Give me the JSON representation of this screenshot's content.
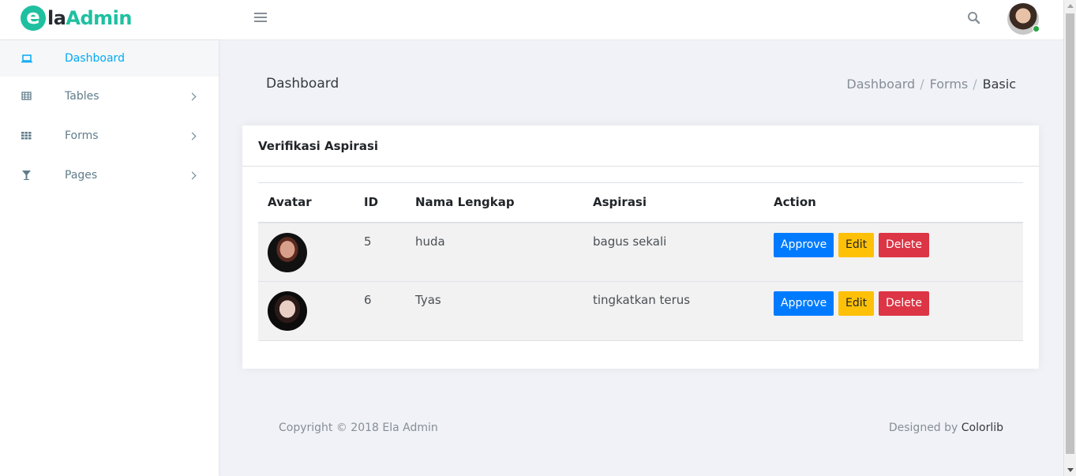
{
  "brand": {
    "logo_e": "e",
    "name_part1": "la",
    "name_part2": "Admin"
  },
  "header": {
    "menu_icon": "hamburger-icon",
    "search_icon": "search-icon",
    "status_color": "#28a745"
  },
  "sidebar": {
    "items": [
      {
        "label": "Dashboard",
        "icon": "laptop-icon",
        "active": true
      },
      {
        "label": "Tables",
        "icon": "table-icon",
        "active": false
      },
      {
        "label": "Forms",
        "icon": "grid-icon",
        "active": false
      },
      {
        "label": "Pages",
        "icon": "glass-icon",
        "active": false
      }
    ]
  },
  "page": {
    "title": "Dashboard",
    "breadcrumb": [
      "Dashboard",
      "Forms",
      "Basic"
    ],
    "breadcrumb_sep": "/"
  },
  "card": {
    "title": "Verifikasi Aspirasi",
    "columns": [
      "Avatar",
      "ID",
      "Nama Lengkap",
      "Aspirasi",
      "Action"
    ],
    "rows": [
      {
        "id": "5",
        "name": "huda",
        "aspirasi": "bagus sekali"
      },
      {
        "id": "6",
        "name": "Tyas",
        "aspirasi": "tingkatkan terus"
      }
    ],
    "actions": {
      "approve": "Approve",
      "edit": "Edit",
      "delete": "Delete"
    }
  },
  "footer": {
    "copyright": "Copyright © 2018 Ela Admin",
    "designed_prefix": "Designed by ",
    "designed_link": "Colorlib"
  },
  "colors": {
    "brand": "#1fc0a0",
    "active": "#03a9f3",
    "approve": "#007bff",
    "edit": "#ffc107",
    "delete": "#dc3545"
  }
}
